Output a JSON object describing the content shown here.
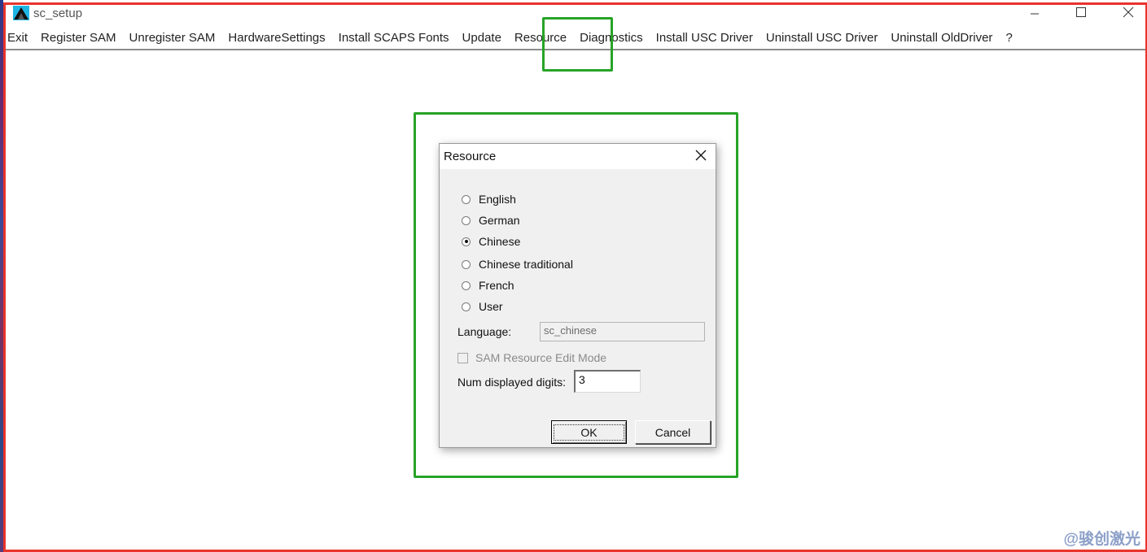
{
  "window": {
    "title": "sc_setup"
  },
  "menu": {
    "items": [
      "Exit",
      "Register SAM",
      "Unregister SAM",
      "HardwareSettings",
      "Install SCAPS Fonts",
      "Update",
      "Resource",
      "Diagnostics",
      "Install USC Driver",
      "Uninstall USC Driver",
      "Uninstall OldDriver",
      "?"
    ]
  },
  "dialog": {
    "title": "Resource",
    "languages": [
      {
        "label": "English",
        "checked": false
      },
      {
        "label": "German",
        "checked": false
      },
      {
        "label": "Chinese",
        "checked": true
      },
      {
        "label": "Chinese traditional",
        "checked": false
      },
      {
        "label": "French",
        "checked": false
      },
      {
        "label": "User",
        "checked": false
      }
    ],
    "language_label": "Language:",
    "language_value": "sc_chinese",
    "edit_mode_label": "SAM Resource Edit Mode",
    "edit_mode_checked": false,
    "digits_label": "Num displayed digits:",
    "digits_value": "3",
    "ok_label": "OK",
    "cancel_label": "Cancel"
  },
  "watermark": "@骏创激光",
  "colors": {
    "highlight_frame": "#e8342c",
    "annotation_box": "#27a327"
  }
}
